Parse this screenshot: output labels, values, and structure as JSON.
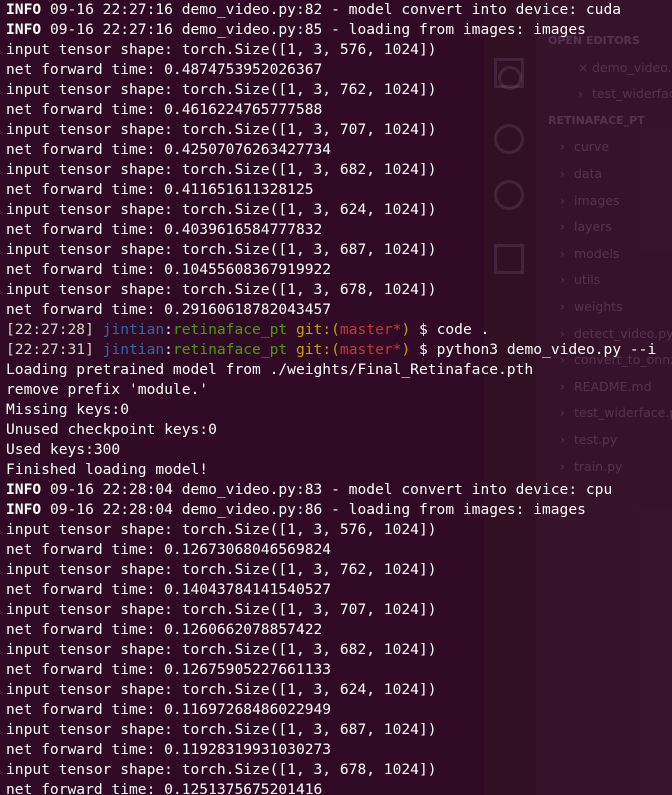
{
  "sidebar": {
    "items": [
      {
        "label": "OPEN EDITORS",
        "kind": "header"
      },
      {
        "label": "demo_video.py",
        "kind": "indent2",
        "icon": "close-icon"
      },
      {
        "label": "test_widerface.py",
        "kind": "indent2"
      },
      {
        "label": "RETINAFACE_PT",
        "kind": "header"
      },
      {
        "label": "curve",
        "kind": "indent1"
      },
      {
        "label": "data",
        "kind": "indent1"
      },
      {
        "label": "images",
        "kind": "indent1"
      },
      {
        "label": "layers",
        "kind": "indent1"
      },
      {
        "label": "models",
        "kind": "indent1"
      },
      {
        "label": "utils",
        "kind": "indent1"
      },
      {
        "label": "weights",
        "kind": "indent1"
      },
      {
        "label": "detect_video.py",
        "kind": "indent1"
      },
      {
        "label": "convert_to_onnx.py",
        "kind": "indent1"
      },
      {
        "label": "README.md",
        "kind": "indent1"
      },
      {
        "label": "test_widerface.py",
        "kind": "indent1"
      },
      {
        "label": "test.py",
        "kind": "indent1"
      },
      {
        "label": "train.py",
        "kind": "indent1"
      }
    ]
  },
  "terminal": {
    "lines": [
      {
        "segs": [
          {
            "t": "INFO",
            "c": "white",
            "b": true
          },
          {
            "t": " 09-16 22:27:16 demo_video.py:82 - model convert into device: cuda",
            "c": "white"
          }
        ]
      },
      {
        "segs": [
          {
            "t": "INFO",
            "c": "white",
            "b": true
          },
          {
            "t": " 09-16 22:27:16 demo_video.py:85 - loading from images: images",
            "c": "white"
          }
        ]
      },
      {
        "segs": [
          {
            "t": "input tensor shape: torch.Size([1, 3, 576, 1024])",
            "c": "white"
          }
        ]
      },
      {
        "segs": [
          {
            "t": "net forward time: 0.4874753952026367",
            "c": "white"
          }
        ]
      },
      {
        "segs": [
          {
            "t": "input tensor shape: torch.Size([1, 3, 762, 1024])",
            "c": "white"
          }
        ]
      },
      {
        "segs": [
          {
            "t": "net forward time: 0.4616224765777588",
            "c": "white"
          }
        ]
      },
      {
        "segs": [
          {
            "t": "input tensor shape: torch.Size([1, 3, 707, 1024])",
            "c": "white"
          }
        ]
      },
      {
        "segs": [
          {
            "t": "net forward time: 0.42507076263427734",
            "c": "white"
          }
        ]
      },
      {
        "segs": [
          {
            "t": "input tensor shape: torch.Size([1, 3, 682, 1024])",
            "c": "white"
          }
        ]
      },
      {
        "segs": [
          {
            "t": "net forward time: 0.411651611328125",
            "c": "white"
          }
        ]
      },
      {
        "segs": [
          {
            "t": "input tensor shape: torch.Size([1, 3, 624, 1024])",
            "c": "white"
          }
        ]
      },
      {
        "segs": [
          {
            "t": "net forward time: 0.4039616584777832",
            "c": "white"
          }
        ]
      },
      {
        "segs": [
          {
            "t": "input tensor shape: torch.Size([1, 3, 687, 1024])",
            "c": "white"
          }
        ]
      },
      {
        "segs": [
          {
            "t": "net forward time: 0.10455608367919922",
            "c": "white"
          }
        ]
      },
      {
        "segs": [
          {
            "t": "input tensor shape: torch.Size([1, 3, 678, 1024])",
            "c": "white"
          }
        ]
      },
      {
        "segs": [
          {
            "t": "net forward time: 0.29160618782043457",
            "c": "white"
          }
        ]
      },
      {
        "segs": [
          {
            "t": "[22:27:28] ",
            "c": "gray"
          },
          {
            "t": "jintian",
            "c": "blue"
          },
          {
            "t": ":",
            "c": "white"
          },
          {
            "t": "retinaface_pt",
            "c": "green"
          },
          {
            "t": " git:(",
            "c": "yellow"
          },
          {
            "t": "master*",
            "c": "red"
          },
          {
            "t": ")",
            "c": "yellow"
          },
          {
            "t": " $ code .",
            "c": "white"
          }
        ]
      },
      {
        "segs": [
          {
            "t": "[22:27:31] ",
            "c": "gray"
          },
          {
            "t": "jintian",
            "c": "blue"
          },
          {
            "t": ":",
            "c": "white"
          },
          {
            "t": "retinaface_pt",
            "c": "green"
          },
          {
            "t": " git:(",
            "c": "yellow"
          },
          {
            "t": "master*",
            "c": "red"
          },
          {
            "t": ")",
            "c": "yellow"
          },
          {
            "t": " $ python3 demo_video.py --i",
            "c": "white"
          }
        ]
      },
      {
        "segs": [
          {
            "t": "Loading pretrained model from ./weights/Final_Retinaface.pth",
            "c": "white"
          }
        ]
      },
      {
        "segs": [
          {
            "t": "remove prefix 'module.'",
            "c": "white"
          }
        ]
      },
      {
        "segs": [
          {
            "t": "Missing keys:0",
            "c": "white"
          }
        ]
      },
      {
        "segs": [
          {
            "t": "Unused checkpoint keys:0",
            "c": "white"
          }
        ]
      },
      {
        "segs": [
          {
            "t": "Used keys:300",
            "c": "white"
          }
        ]
      },
      {
        "segs": [
          {
            "t": "Finished loading model!",
            "c": "white"
          }
        ]
      },
      {
        "segs": [
          {
            "t": "INFO",
            "c": "white",
            "b": true
          },
          {
            "t": " 09-16 22:28:04 demo_video.py:83 - model convert into device: cpu",
            "c": "white"
          }
        ]
      },
      {
        "segs": [
          {
            "t": "INFO",
            "c": "white",
            "b": true
          },
          {
            "t": " 09-16 22:28:04 demo_video.py:86 - loading from images: images",
            "c": "white"
          }
        ]
      },
      {
        "segs": [
          {
            "t": "input tensor shape: torch.Size([1, 3, 576, 1024])",
            "c": "white"
          }
        ]
      },
      {
        "segs": [
          {
            "t": "net forward time: 0.12673068046569824",
            "c": "white"
          }
        ]
      },
      {
        "segs": [
          {
            "t": "input tensor shape: torch.Size([1, 3, 762, 1024])",
            "c": "white"
          }
        ]
      },
      {
        "segs": [
          {
            "t": "net forward time: 0.14043784141540527",
            "c": "white"
          }
        ]
      },
      {
        "segs": [
          {
            "t": "input tensor shape: torch.Size([1, 3, 707, 1024])",
            "c": "white"
          }
        ]
      },
      {
        "segs": [
          {
            "t": "net forward time: 0.1260662078857422",
            "c": "white"
          }
        ]
      },
      {
        "segs": [
          {
            "t": "input tensor shape: torch.Size([1, 3, 682, 1024])",
            "c": "white"
          }
        ]
      },
      {
        "segs": [
          {
            "t": "net forward time: 0.12675905227661133",
            "c": "white"
          }
        ]
      },
      {
        "segs": [
          {
            "t": "input tensor shape: torch.Size([1, 3, 624, 1024])",
            "c": "white"
          }
        ]
      },
      {
        "segs": [
          {
            "t": "net forward time: 0.11697268486022949",
            "c": "white"
          }
        ]
      },
      {
        "segs": [
          {
            "t": "input tensor shape: torch.Size([1, 3, 687, 1024])",
            "c": "white"
          }
        ]
      },
      {
        "segs": [
          {
            "t": "net forward time: 0.11928319931030273",
            "c": "white"
          }
        ]
      },
      {
        "segs": [
          {
            "t": "input tensor shape: torch.Size([1, 3, 678, 1024])",
            "c": "white"
          }
        ]
      },
      {
        "segs": [
          {
            "t": "net forward time: 0.1251375675201416",
            "c": "white"
          }
        ]
      }
    ]
  },
  "colors": {
    "background": "#300a24",
    "white": "#ffffff",
    "gray": "#d3d7cf",
    "blue": "#3465a4",
    "green": "#4e9a06",
    "yellow": "#c4a000",
    "red": "#cc3333"
  }
}
